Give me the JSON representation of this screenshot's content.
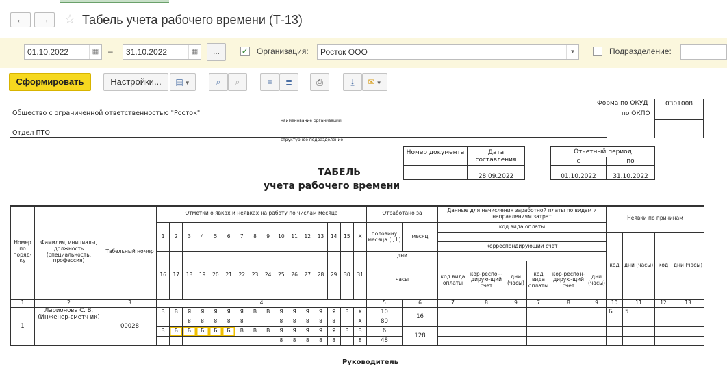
{
  "window": {
    "title": "Табель учета рабочего времени (Т-13)"
  },
  "filters": {
    "date_from": "01.10.2022",
    "date_separator": "–",
    "date_to": "31.10.2022",
    "more_button": "...",
    "org_checked": true,
    "org_label": "Организация:",
    "org_value": "Росток ООО",
    "dept_checked": false,
    "dept_label": "Подразделение:",
    "dept_value": ""
  },
  "toolbar": {
    "generate_label": "Сформировать",
    "settings_label": "Настройки...",
    "icons": [
      "variants-icon",
      "search-icon",
      "search-next-icon",
      "collapse-groups-icon",
      "expand-groups-icon",
      "print-icon",
      "save-icon",
      "mail-icon"
    ]
  },
  "form": {
    "okud_label": "Форма по ОКУД",
    "okud_value": "0301008",
    "okpo_label": "по ОКПО",
    "okpo_value": "",
    "org_name": "Общество с ограниченной ответственностью \"Росток\"",
    "org_caption": "наименование организации",
    "dept_name": "Отдел ПТО",
    "dept_caption": "структурное подразделение",
    "doc_number_label": "Номер документа",
    "doc_number_value": "",
    "doc_date_label": "Дата составления",
    "doc_date_value": "28.09.2022",
    "period_label": "Отчетный период",
    "period_from_label": "с",
    "period_to_label": "по",
    "period_from": "01.10.2022",
    "period_to": "31.10.2022",
    "heading1": "ТАБЕЛЬ",
    "heading2": "учета  рабочего времени"
  },
  "table": {
    "h_num": "Номер по поряд-ку",
    "h_name": "Фамилия, инициалы, должность (специальность, профессия)",
    "h_tab": "Табельный номер",
    "h_marks": "Отметки о явках и неявках на работу по числам месяца",
    "days_top": [
      "1",
      "2",
      "3",
      "4",
      "5",
      "6",
      "7",
      "8",
      "9",
      "10",
      "11",
      "12",
      "13",
      "14",
      "15",
      "Х"
    ],
    "days_bottom": [
      "16",
      "17",
      "18",
      "19",
      "20",
      "21",
      "22",
      "23",
      "24",
      "25",
      "26",
      "27",
      "28",
      "29",
      "30",
      "31"
    ],
    "h_worked": "Отработано за",
    "h_half": "половину месяца (I, II)",
    "h_month": "месяц",
    "h_days": "дни",
    "h_hours": "часы",
    "h_salary": "Данные для начисления заработной платы по видам и направлениям затрат",
    "h_paycode": "код вида оплаты",
    "h_corr": "корреспондирующий счет",
    "h_code_pay": "код вида оплаты",
    "h_corr_acc": "коp-респон-дирую-щий счет",
    "h_days_hours": "дни (часы)",
    "h_absence": "Неявки по причинам",
    "h_code": "код",
    "col_numbers": [
      "1",
      "2",
      "3",
      "4",
      "5",
      "6",
      "7",
      "8",
      "9",
      "7",
      "8",
      "9",
      "10",
      "11",
      "12",
      "13"
    ],
    "row": {
      "num": "1",
      "name": "Ларионова С. В. (Инженер-сметч ик)",
      "tab": "00028",
      "marks_top": [
        "В",
        "В",
        "Я",
        "Я",
        "Я",
        "Я",
        "Я",
        "В",
        "В",
        "Я",
        "Я",
        "Я",
        "Я",
        "Я",
        "В",
        "Х"
      ],
      "hours_top": [
        "",
        "",
        "8",
        "8",
        "8",
        "8",
        "8",
        "",
        "",
        "8",
        "8",
        "8",
        "8",
        "8",
        "",
        "Х"
      ],
      "marks_bottom": [
        "В",
        "Б",
        "Б",
        "Б",
        "Б",
        "Б",
        "В",
        "В",
        "В",
        "Я",
        "Я",
        "Я",
        "Я",
        "Я",
        "В",
        "В"
      ],
      "hours_bottom": [
        "",
        "",
        "",
        "",
        "",
        "",
        "",
        "",
        "",
        "8",
        "8",
        "8",
        "8",
        "8",
        "",
        "8"
      ],
      "half1_days": "10",
      "half1_hours": "80",
      "half2_days": "6",
      "half2_hours": "48",
      "month_days": "16",
      "month_hours": "128",
      "absence_code": "Б",
      "absence_days": "5"
    }
  },
  "footer": {
    "head_label": "Руководитель"
  }
}
